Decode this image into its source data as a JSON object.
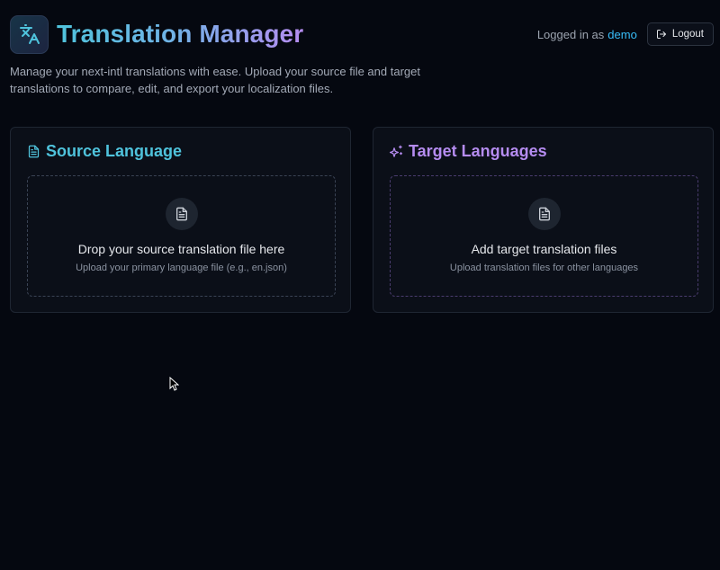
{
  "app": {
    "title": "Translation Manager",
    "description": "Manage your next-intl translations with ease. Upload your source file and target translations to compare, edit, and export your localization files."
  },
  "user": {
    "logged_in_prefix": "Logged in as",
    "username": "demo",
    "logout_label": "Logout"
  },
  "source": {
    "title": "Source Language",
    "drop_title": "Drop your source translation file here",
    "drop_subtitle": "Upload your primary language file (e.g., en.json)"
  },
  "target": {
    "title": "Target Languages",
    "drop_title": "Add target translation files",
    "drop_subtitle": "Upload translation files for other languages"
  },
  "icons": {
    "logo": "translate-icon",
    "logout": "logout-icon",
    "source": "file-text-icon",
    "target": "sparkles-icon",
    "dropzone": "file-icon"
  },
  "colors": {
    "background": "#050810",
    "accent_cyan": "#4fc3dc",
    "accent_purple": "#b58cf0",
    "username": "#38bdf8"
  }
}
